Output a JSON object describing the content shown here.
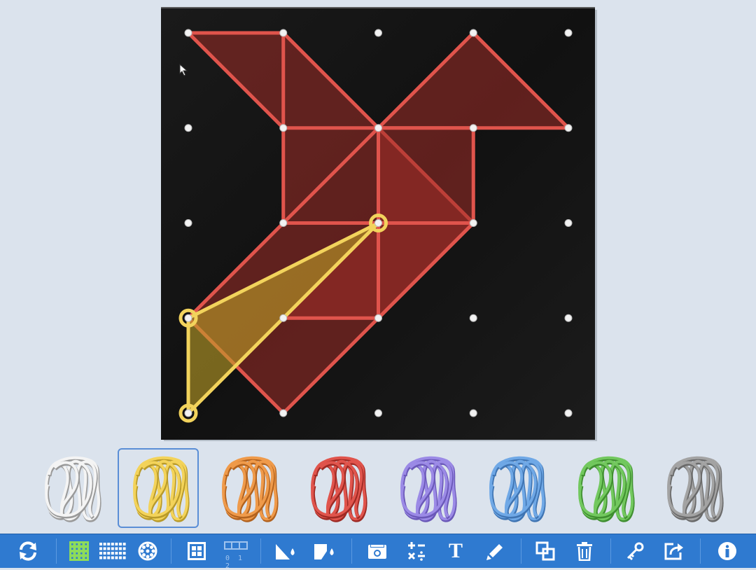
{
  "board": {
    "grid_size": 5,
    "colors": {
      "board": "#121212",
      "peg": "#f2f2f2"
    },
    "shapes": [
      {
        "name": "red-shape",
        "color": "#e0544c",
        "fill": "rgba(160,45,40,0.55)",
        "points": [
          [
            0,
            0
          ],
          [
            1,
            0
          ],
          [
            3,
            2
          ],
          [
            1,
            4
          ],
          [
            0,
            3
          ],
          [
            1,
            2
          ],
          [
            1,
            1
          ]
        ]
      },
      {
        "name": "red-shape",
        "color": "#e0544c",
        "fill": "rgba(160,45,40,0.55)",
        "points": [
          [
            3,
            0
          ],
          [
            4,
            1
          ],
          [
            2,
            1
          ]
        ]
      },
      {
        "name": "red-shape",
        "color": "#e0544c",
        "fill": "rgba(160,45,40,0.55)",
        "points": [
          [
            2,
            1
          ],
          [
            3,
            1
          ],
          [
            3,
            2
          ],
          [
            2,
            3
          ],
          [
            1,
            3
          ],
          [
            2,
            2
          ]
        ]
      },
      {
        "name": "red-line",
        "color": "#e0544c",
        "fill": "none",
        "open": true,
        "points": [
          [
            1,
            0
          ],
          [
            1,
            1
          ],
          [
            2,
            1
          ],
          [
            1,
            2
          ]
        ]
      },
      {
        "name": "red-line",
        "color": "#e0544c",
        "fill": "none",
        "open": true,
        "points": [
          [
            1,
            2
          ],
          [
            3,
            2
          ]
        ]
      },
      {
        "name": "red-line",
        "color": "#e0544c",
        "fill": "none",
        "open": true,
        "points": [
          [
            2,
            2
          ],
          [
            2,
            3
          ]
        ]
      },
      {
        "name": "yellow-shape",
        "color": "#f2d35c",
        "fill": "rgba(190,160,40,0.6)",
        "selected": true,
        "points": [
          [
            2,
            2
          ],
          [
            0,
            3
          ],
          [
            0,
            4
          ]
        ]
      }
    ]
  },
  "bands": [
    {
      "name": "white",
      "color": "#f4f4f4",
      "shadow": "#9a9a9a"
    },
    {
      "name": "yellow",
      "color": "#f3d35a",
      "shadow": "#b89a2a",
      "selected": true
    },
    {
      "name": "orange",
      "color": "#ef9a4a",
      "shadow": "#b2621e"
    },
    {
      "name": "red",
      "color": "#e0544c",
      "shadow": "#9e2a24"
    },
    {
      "name": "purple",
      "color": "#9b8ae6",
      "shadow": "#6a58b8"
    },
    {
      "name": "blue",
      "color": "#6fa8e6",
      "shadow": "#3f74b2"
    },
    {
      "name": "green",
      "color": "#72c85e",
      "shadow": "#3f8e30"
    },
    {
      "name": "gray",
      "color": "#a3a3a3",
      "shadow": "#6a6a6a"
    }
  ],
  "toolbar": {
    "background": "#2f7ad0",
    "number_line_label": "0 1 2",
    "text_tool_label": "T",
    "icons": [
      "refresh-icon",
      "square-grid-icon",
      "rect-grid-icon",
      "circle-grid-icon",
      "grid-frame-icon",
      "number-line-icon",
      "triangle-fill-icon",
      "shape-fill-icon",
      "measure-icon",
      "calculator-icon",
      "text-icon",
      "pen-icon",
      "duplicate-icon",
      "trash-icon",
      "key-icon",
      "share-icon",
      "info-icon"
    ]
  }
}
